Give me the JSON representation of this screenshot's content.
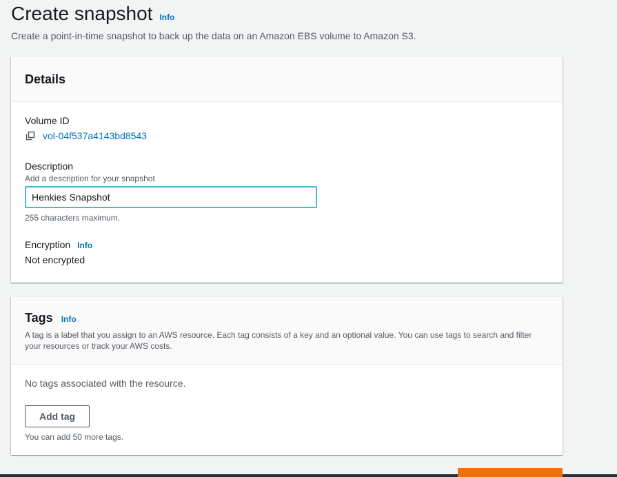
{
  "header": {
    "title": "Create snapshot",
    "info": "Info",
    "description": "Create a point-in-time snapshot to back up the data on an Amazon EBS volume to Amazon S3."
  },
  "details": {
    "title": "Details",
    "volume_id_label": "Volume ID",
    "volume_id": "vol-04f537a4143bd8543",
    "description_label": "Description",
    "description_hint": "Add a description for your snapshot",
    "description_value": "Henkies Snapshot",
    "description_constraint": "255 characters maximum.",
    "encryption_label": "Encryption",
    "encryption_info": "Info",
    "encryption_value": "Not encrypted"
  },
  "tags": {
    "title": "Tags",
    "info": "Info",
    "description": "A tag is a label that you assign to an AWS resource. Each tag consists of a key and an optional value. You can use tags to search and filter your resources or track your AWS costs.",
    "empty_text": "No tags associated with the resource.",
    "add_button": "Add tag",
    "limit_text": "You can add 50 more tags."
  },
  "colors": {
    "link": "#0073bb",
    "input_focus": "#44b9d6",
    "primary": "#ec7211",
    "background": "#f2f3f3"
  }
}
